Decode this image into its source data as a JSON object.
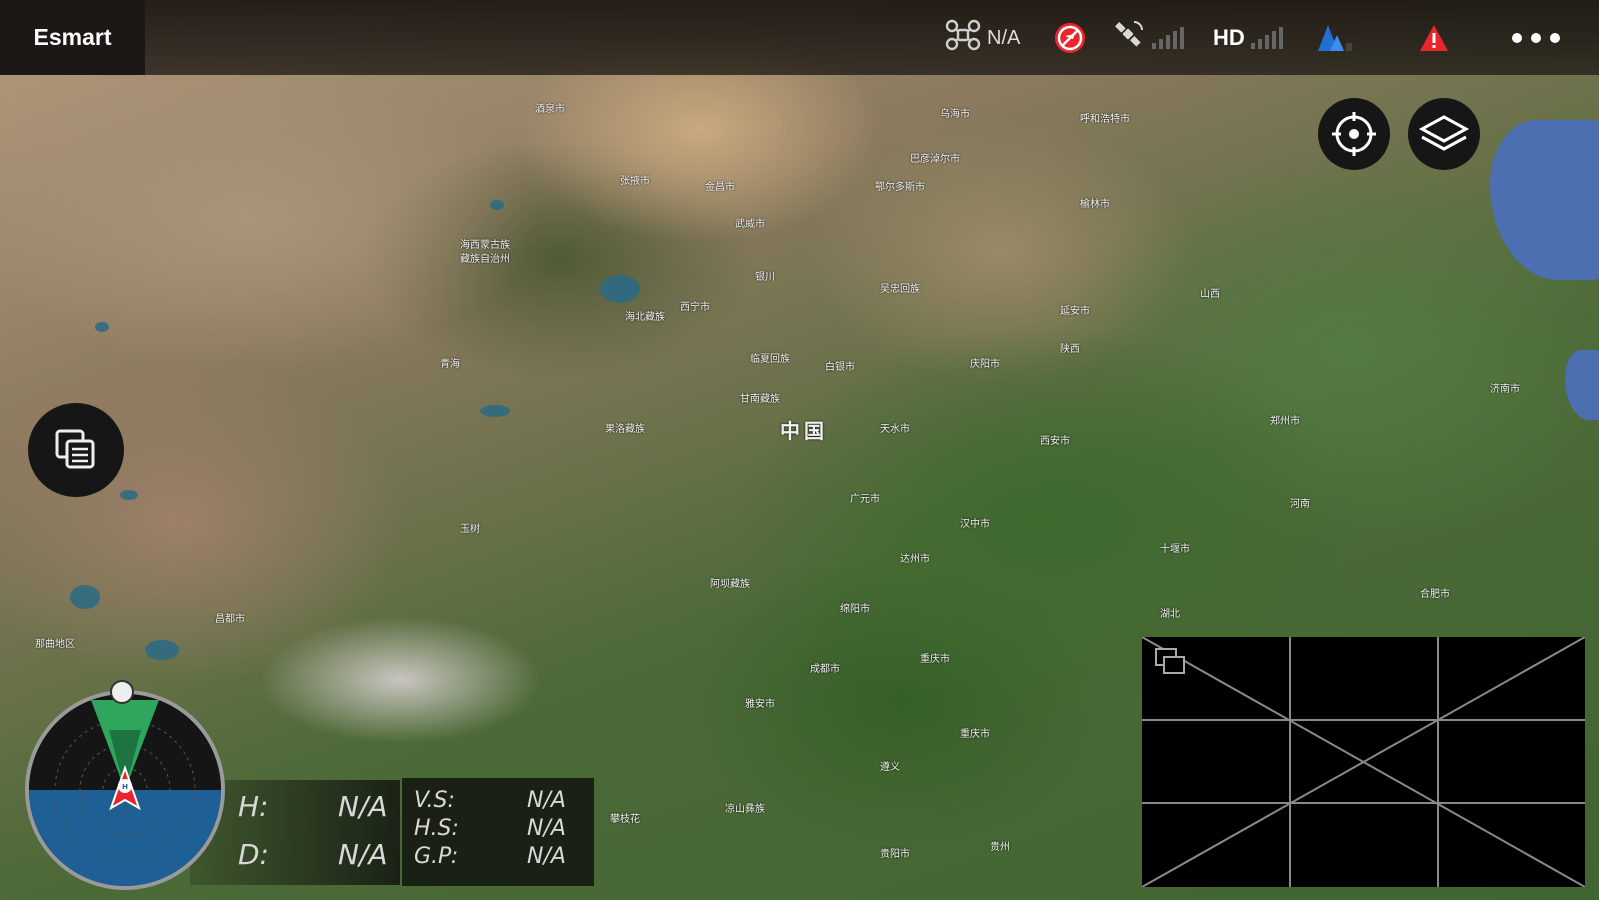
{
  "app": {
    "title": "Esmart"
  },
  "topbar": {
    "aircraft_status": "N/A",
    "hd_label": "HD"
  },
  "map": {
    "country_label": "中国"
  },
  "telemetry": {
    "h_label": "H:",
    "h_value": "N/A",
    "d_label": "D:",
    "d_value": "N/A",
    "vs_label": "V.S:",
    "vs_value": "N/A",
    "hs_label": "H.S:",
    "hs_value": "N/A",
    "gp_label": "G.P:",
    "gp_value": "N/A"
  },
  "icons": {
    "drone": "drone-icon",
    "no_fly": "no-fly-icon",
    "satellite": "satellite-icon",
    "hd_signal": "hd-signal-icon",
    "battery": "battery-icon",
    "warning": "warning-icon",
    "more": "more-icon",
    "locate": "locate-icon",
    "layers": "layers-icon",
    "switch_view": "switch-view-icon",
    "radar": "radar-icon"
  },
  "colors": {
    "warning": "#e8262b",
    "battery": "#1f6fd6",
    "radar_ground": "#1e5f95",
    "radar_beam": "#2fae62",
    "aircraft": "#e8262b"
  }
}
